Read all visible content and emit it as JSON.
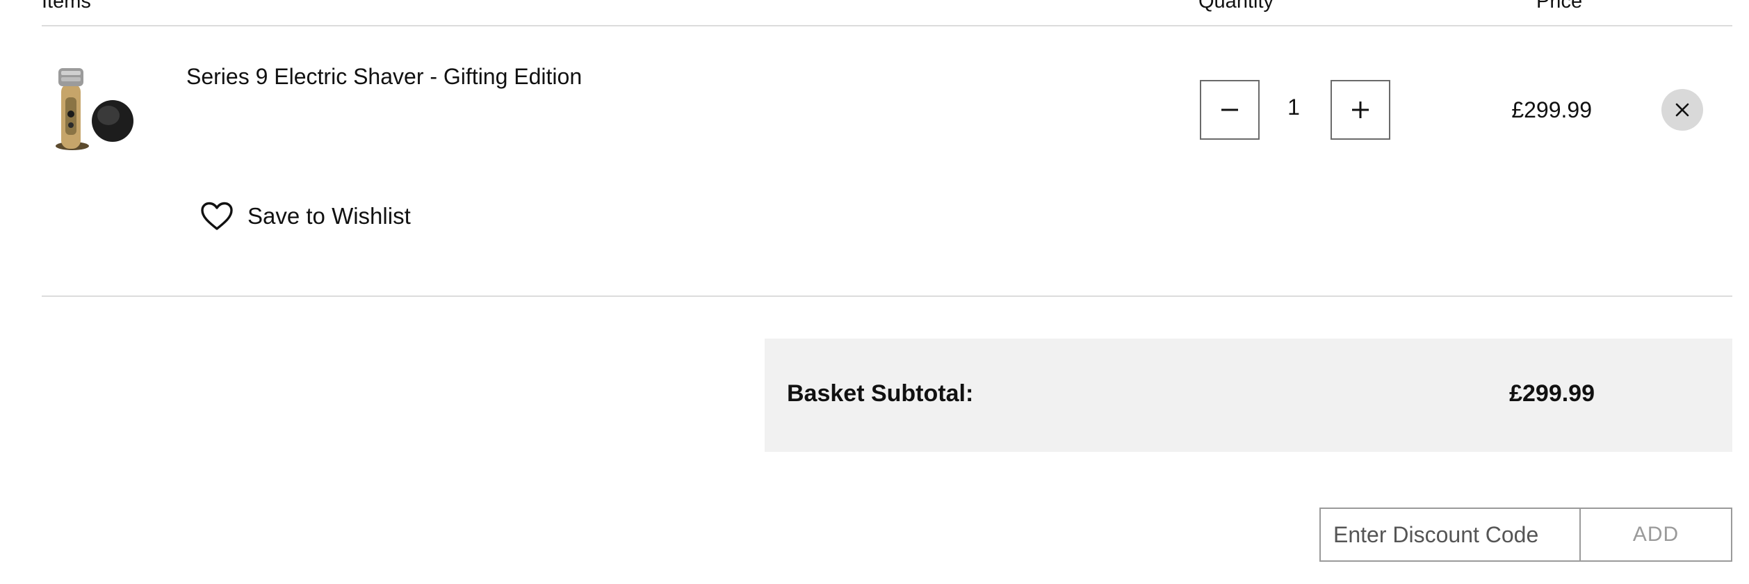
{
  "table_header": {
    "items_label": "Items",
    "quantity_label": "Quantity",
    "price_label": "Price"
  },
  "line_item": {
    "name": "Series 9 Electric Shaver - Gifting Edition",
    "thumbnail_icon": "electric-shaver-product-image",
    "quantity": "1",
    "price": "£299.99",
    "decrease_icon": "minus-icon",
    "increase_icon": "plus-icon",
    "remove_icon": "close-icon",
    "wishlist_icon": "heart-icon",
    "wishlist_label": "Save to Wishlist"
  },
  "summary": {
    "subtotal_label": "Basket Subtotal:",
    "subtotal_value": "£299.99"
  },
  "discount": {
    "placeholder": "Enter Discount Code",
    "value": "",
    "add_label": "ADD"
  },
  "colors": {
    "panel_bg": "#f1f1f1",
    "remove_bg": "#d9d9d9",
    "divider": "#dcdcdc",
    "muted_button_text": "#9a9a9a"
  }
}
